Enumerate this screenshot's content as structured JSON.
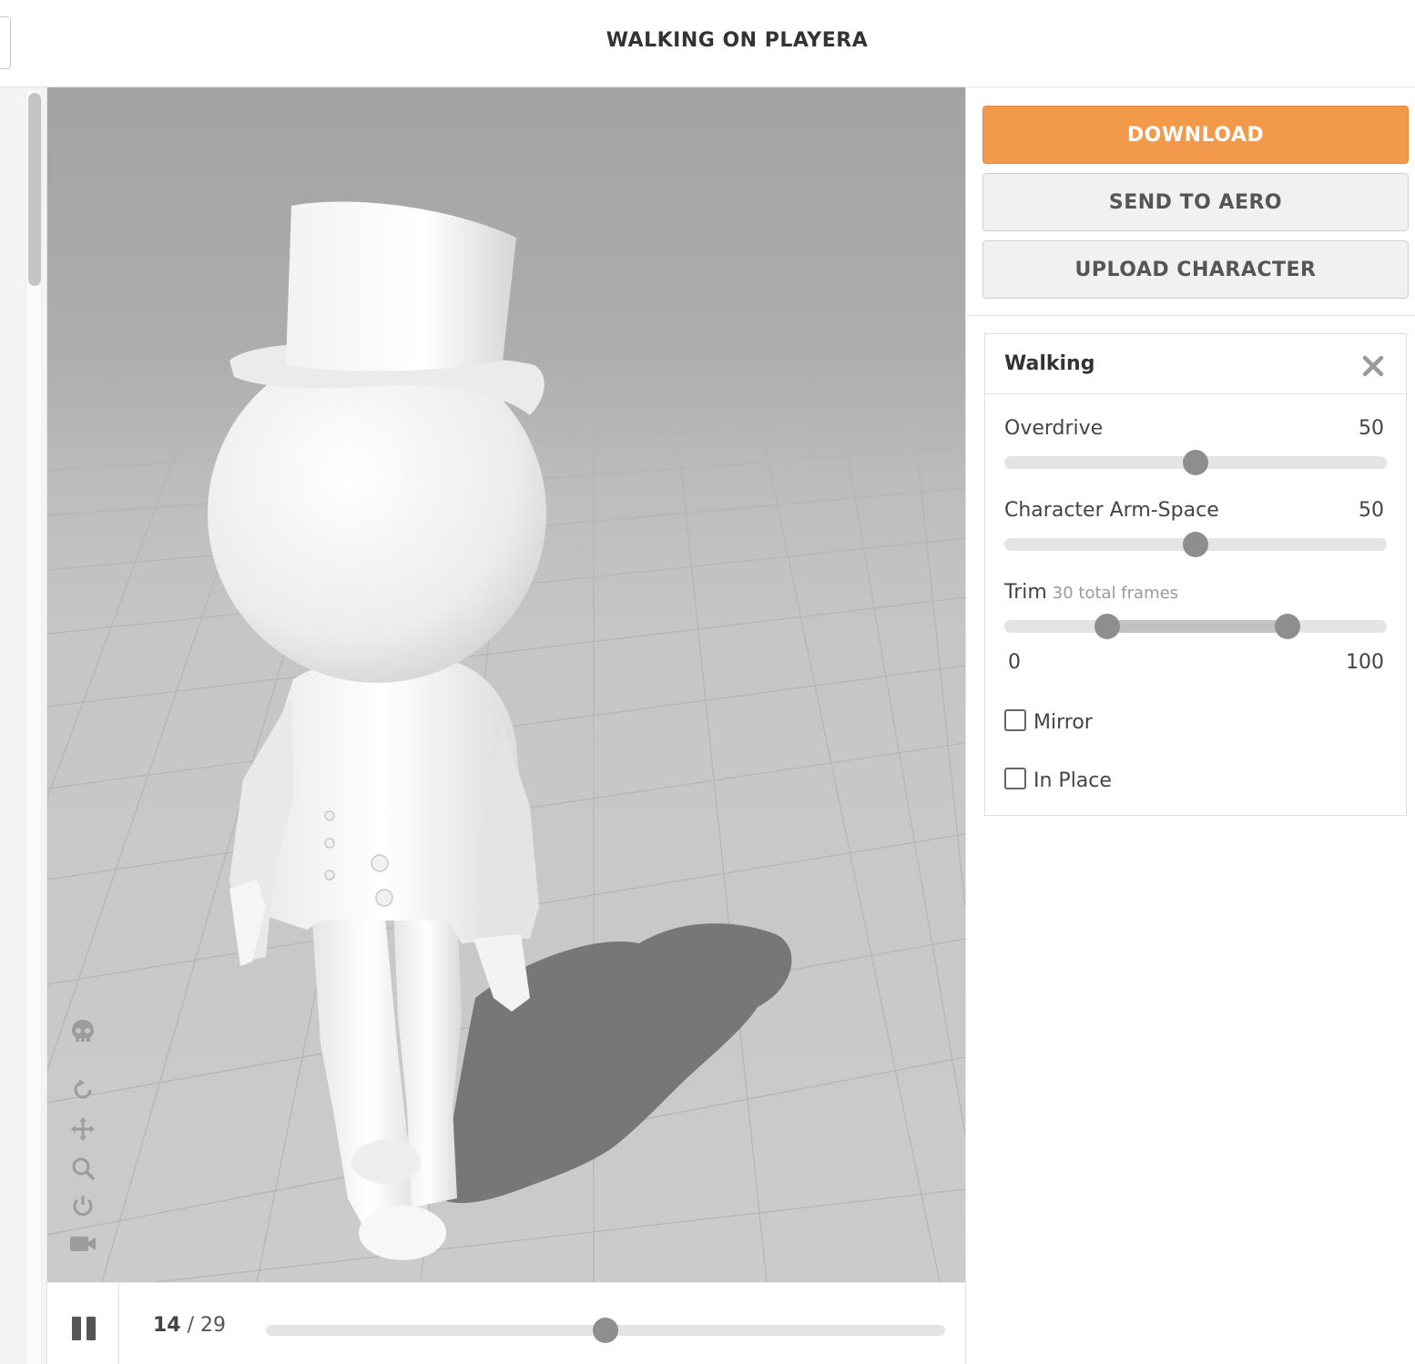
{
  "header": {
    "title": "WALKING ON PLAYERA"
  },
  "actions": {
    "download_label": "DOWNLOAD",
    "send_label": "SEND TO AERO",
    "upload_label": "UPLOAD CHARACTER"
  },
  "panel": {
    "title": "Walking",
    "overdrive": {
      "label": "Overdrive",
      "value": "50",
      "fraction": 0.5
    },
    "arm_space": {
      "label": "Character Arm-Space",
      "value": "50",
      "fraction": 0.5
    },
    "trim": {
      "label": "Trim",
      "note": "30 total frames",
      "min_label": "0",
      "max_label": "100",
      "start_fraction": 0.27,
      "end_fraction": 0.74
    },
    "mirror_label": "Mirror",
    "mirror_checked": false,
    "in_place_label": "In Place",
    "in_place_checked": false
  },
  "playback": {
    "current_frame": "14",
    "separator": "/",
    "total_frames": "29",
    "progress_fraction": 0.5
  },
  "viewport_tools": [
    "skeleton-icon",
    "rotate-icon",
    "pan-icon",
    "zoom-icon",
    "power-icon",
    "camera-icon"
  ],
  "colors": {
    "accent": "#f2994a",
    "knob": "#8e8e8e",
    "track": "#e4e4e4"
  }
}
